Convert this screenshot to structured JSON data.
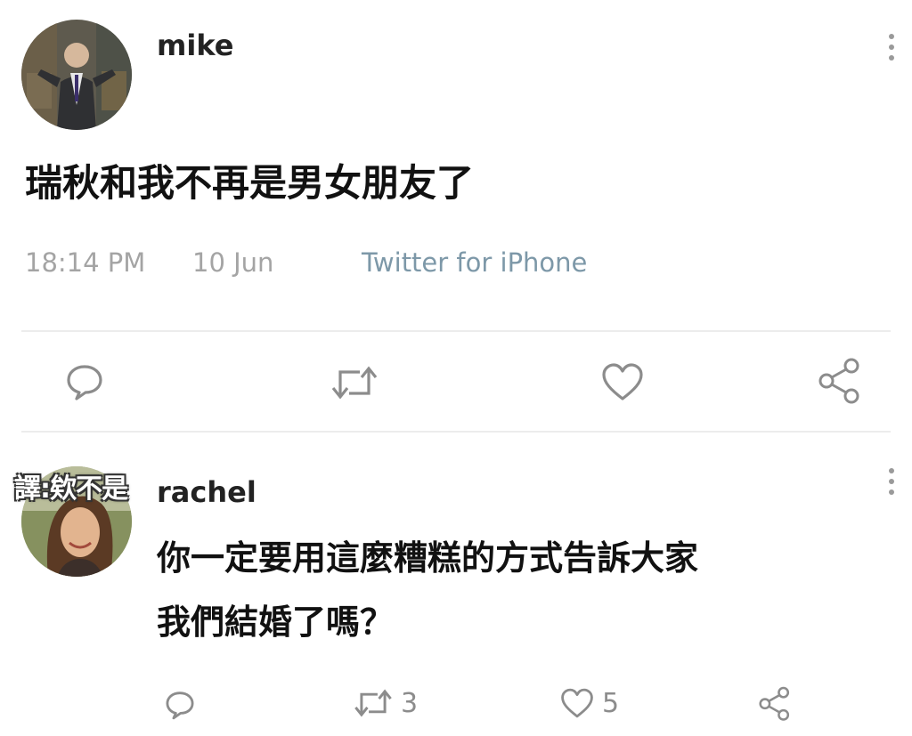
{
  "tweet": {
    "username": "mike",
    "text": "瑞秋和我不再是男女朋友了",
    "time": "18:14 PM",
    "date": "10 Jun",
    "source": "Twitter for iPhone",
    "avatar_icon": "person-avatar"
  },
  "reply": {
    "username": "rachel",
    "text_line1": "你一定要用這麼糟糕的方式告訴大家",
    "text_line2": "我們結婚了嗎？",
    "retweet_count": "3",
    "like_count": "5",
    "avatar_icon": "person-avatar"
  },
  "watermark": "譯:欸不是",
  "colors": {
    "meta_gray": "#a4a4a4",
    "source_blue": "#7d98a8",
    "icon_gray": "#8c8c8c"
  },
  "icons": [
    "reply-icon",
    "retweet-icon",
    "like-icon",
    "share-icon",
    "more-options-icon"
  ]
}
